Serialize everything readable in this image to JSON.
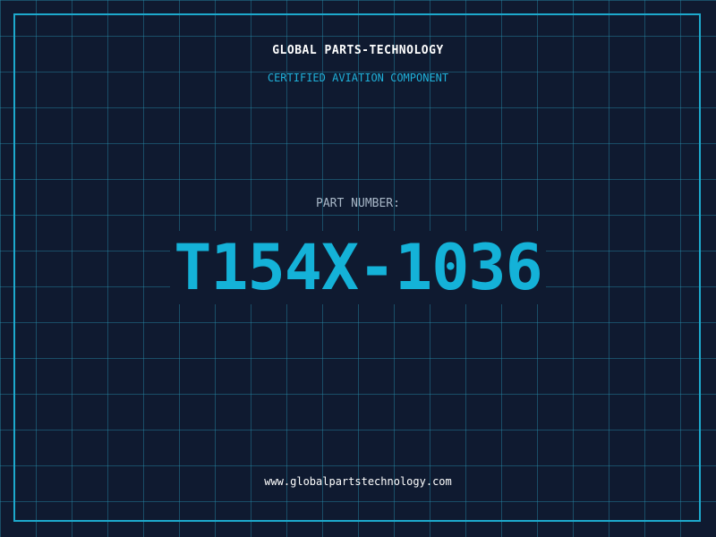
{
  "header": {
    "company": "GLOBAL PARTS-TECHNOLOGY",
    "tagline": "CERTIFIED AVIATION COMPONENT"
  },
  "part": {
    "label": "PART NUMBER:",
    "number": "T154X-1036"
  },
  "footer": {
    "website": "www.globalpartstechnology.com"
  },
  "colors": {
    "background": "#0f1a30",
    "grid": "#288caa",
    "accent": "#1da9cc",
    "part_number": "#14b2d8",
    "label": "#a8b7c7",
    "text": "#ffffff"
  }
}
